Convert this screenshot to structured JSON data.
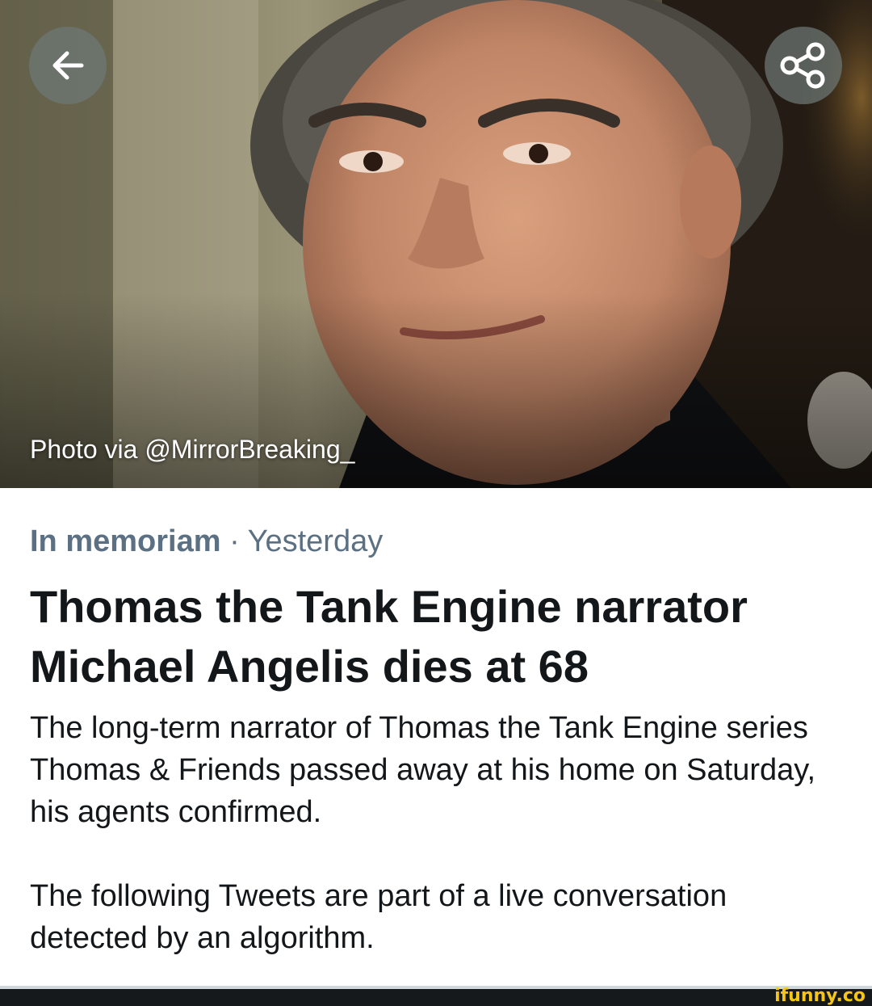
{
  "hero": {
    "caption": "Photo via @MirrorBreaking_",
    "back_icon": "arrow-left-icon",
    "share_icon": "share-icon"
  },
  "article": {
    "category": "In memoriam",
    "separator": "·",
    "time": "Yesterday",
    "headline": "Thomas the Tank Engine narrator Michael Angelis dies at 68",
    "summary": "The long-term narrator of Thomas the Tank Engine series Thomas & Friends passed away at his home on Saturday, his agents confirmed.",
    "note": "The following Tweets are part of a live conversation detected by an algorithm."
  },
  "watermark": {
    "text": "ifunny.co"
  },
  "colors": {
    "meta_text": "#5b7083",
    "body_text": "#14171a",
    "button_bg": "#6e7876",
    "watermark": "#f5c518"
  }
}
